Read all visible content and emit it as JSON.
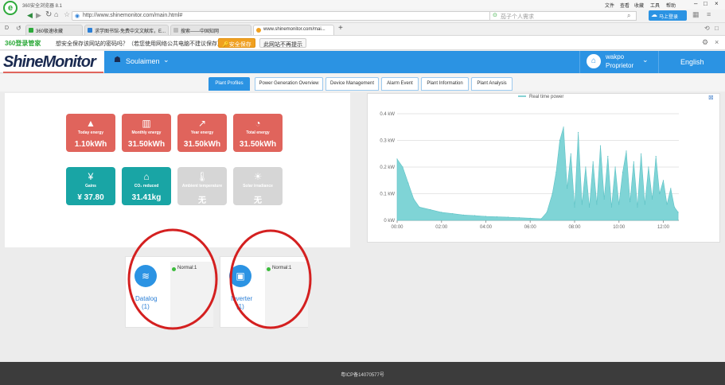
{
  "browser": {
    "title": "360安全浏览器 8.1",
    "menu": [
      "文件",
      "查看",
      "收藏",
      "工具",
      "帮助"
    ],
    "url": "http://www.shinemonitor.com/main.html#",
    "search_placeholder": "茄子个人需求",
    "login_button": "马上登录",
    "tabs": [
      {
        "label": "360极速收藏"
      },
      {
        "label": "求学图书馆-免费中文文献库，E..."
      },
      {
        "label": "搜索——中国知网"
      },
      {
        "label": "www.shinemonitor.com/mai..."
      }
    ],
    "new_tab": "+",
    "notification": {
      "brand": "360登录管家",
      "question": "想安全保存该网站的密码吗？（若您使用网络公共电脑不建议保存）",
      "save_button": "安全保存",
      "never_button": "此网站不再提示"
    }
  },
  "app": {
    "logo": "ShineMonitor",
    "plant_name": "Soulaimen",
    "user_name": "wakpo",
    "user_role": "Proprietor",
    "language": "English",
    "nav_tabs": [
      "Plant Profiles",
      "Power Generation Overview",
      "Device Management",
      "Alarm Event",
      "Plant Information",
      "Plant Analysis"
    ],
    "active_tab": "Plant Profiles",
    "stat_cards": [
      {
        "icon": "mountain-chart-icon",
        "label": "Today energy",
        "value": "1.10kWh",
        "color": "#e0645c"
      },
      {
        "icon": "bar-chart-icon",
        "label": "Monthly energy",
        "value": "31.50kWh",
        "color": "#e0645c"
      },
      {
        "icon": "trend-line-icon",
        "label": "Year energy",
        "value": "31.50kWh",
        "color": "#e0645c"
      },
      {
        "icon": "pie-chart-icon",
        "label": "Total energy",
        "value": "31.50kWh",
        "color": "#e0645c"
      },
      {
        "icon": "yen-icon",
        "label": "Gains",
        "value": "¥ 37.80",
        "color": "#19a5a5"
      },
      {
        "icon": "factory-icon",
        "label": "CO₂ reduced",
        "value": "31.41kg",
        "color": "#19a5a5"
      },
      {
        "icon": "thermometer-icon",
        "label": "Ambient temperature",
        "value": "无",
        "color": "#d6d6d6"
      },
      {
        "icon": "sun-icon",
        "label": "Solar irradiance",
        "value": "无",
        "color": "#d6d6d6"
      }
    ],
    "devices": [
      {
        "name": "Datalog",
        "count": "(1)",
        "status": "Normal:1"
      },
      {
        "name": "Inverter",
        "count": "(1)",
        "status": "Normal:1"
      }
    ],
    "footer": "粤ICP备14070577号"
  },
  "chart_data": {
    "type": "area",
    "title": "",
    "legend": [
      "Real time power"
    ],
    "ylabel": "",
    "y_ticks": [
      "0 kW",
      "0.1 kW",
      "0.2 kW",
      "0.3 kW",
      "0.4 kW"
    ],
    "x_ticks": [
      "00:00",
      "02:00",
      "04:00",
      "06:00",
      "08:00",
      "10:00",
      "12:00"
    ],
    "ylim": [
      0,
      0.4
    ],
    "xlim_hours": [
      0,
      12.7
    ],
    "color": "#7fd4d6",
    "series": [
      {
        "name": "Real time power",
        "x": [
          "00:00",
          "00:15",
          "00:30",
          "00:45",
          "01:00",
          "01:30",
          "02:00",
          "02:30",
          "03:00",
          "03:30",
          "04:00",
          "04:30",
          "05:00",
          "05:30",
          "06:00",
          "06:30",
          "06:45",
          "07:00",
          "07:10",
          "07:20",
          "07:30",
          "07:40",
          "07:50",
          "08:00",
          "08:10",
          "08:20",
          "08:30",
          "08:40",
          "08:50",
          "09:00",
          "09:10",
          "09:20",
          "09:30",
          "09:40",
          "09:50",
          "10:00",
          "10:10",
          "10:20",
          "10:30",
          "10:40",
          "10:50",
          "11:00",
          "11:10",
          "11:20",
          "11:30",
          "11:40",
          "11:50",
          "12:00",
          "12:10",
          "12:20",
          "12:30",
          "12:40"
        ],
        "values": [
          0.23,
          0.2,
          0.14,
          0.08,
          0.05,
          0.04,
          0.03,
          0.025,
          0.02,
          0.018,
          0.015,
          0.013,
          0.012,
          0.01,
          0.008,
          0.006,
          0.03,
          0.1,
          0.18,
          0.3,
          0.35,
          0.12,
          0.25,
          0.05,
          0.33,
          0.06,
          0.2,
          0.05,
          0.22,
          0.06,
          0.28,
          0.08,
          0.24,
          0.05,
          0.2,
          0.06,
          0.18,
          0.26,
          0.07,
          0.22,
          0.05,
          0.25,
          0.06,
          0.2,
          0.08,
          0.24,
          0.1,
          0.15,
          0.06,
          0.12,
          0.05,
          0.03
        ]
      }
    ]
  }
}
